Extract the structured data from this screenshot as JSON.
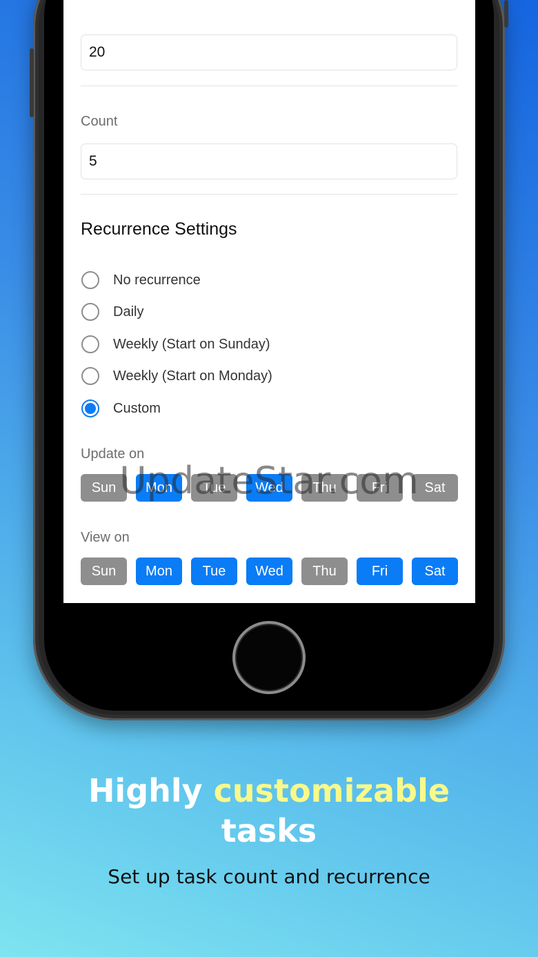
{
  "form": {
    "first_value": "20",
    "count_label": "Count",
    "count_value": "5"
  },
  "recurrence": {
    "title": "Recurrence Settings",
    "options": [
      {
        "label": "No recurrence",
        "checked": false
      },
      {
        "label": "Daily",
        "checked": false
      },
      {
        "label": "Weekly (Start on Sunday)",
        "checked": false
      },
      {
        "label": "Weekly (Start on Monday)",
        "checked": false
      },
      {
        "label": "Custom",
        "checked": true
      }
    ]
  },
  "update_on": {
    "label": "Update on",
    "days": [
      {
        "label": "Sun",
        "on": false
      },
      {
        "label": "Mon",
        "on": true
      },
      {
        "label": "Tue",
        "on": false
      },
      {
        "label": "Wed",
        "on": true
      },
      {
        "label": "Thu",
        "on": false
      },
      {
        "label": "Fri",
        "on": false
      },
      {
        "label": "Sat",
        "on": false
      }
    ]
  },
  "view_on": {
    "label": "View on",
    "days": [
      {
        "label": "Sun",
        "on": false
      },
      {
        "label": "Mon",
        "on": true
      },
      {
        "label": "Tue",
        "on": true
      },
      {
        "label": "Wed",
        "on": true
      },
      {
        "label": "Thu",
        "on": false
      },
      {
        "label": "Fri",
        "on": true
      },
      {
        "label": "Sat",
        "on": true
      }
    ]
  },
  "colors": {
    "accent": "#0a7cf5",
    "day_off": "#8e8e8e",
    "headline_highlight": "#f8f98a"
  },
  "watermark": "UpdateStar.com",
  "promo": {
    "headline_part1": "Highly ",
    "headline_highlight": "customizable",
    "headline_part2": "tasks",
    "subline": "Set up task count and recurrence"
  }
}
